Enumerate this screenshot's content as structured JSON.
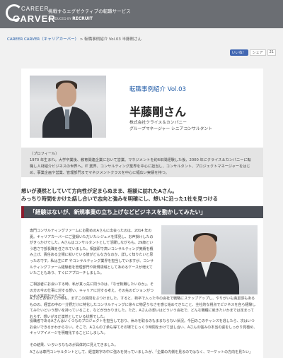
{
  "header": {
    "logo_line1": "CAREER",
    "logo_line2": "CARVER",
    "tagline": "挑戦するエグゼクティブの転職サービス",
    "produced_label": "PRODUCED BY",
    "produced_brand": "RECRUIT"
  },
  "breadcrumb": {
    "home": "CAREER CARVER（キャリアカーバー）",
    "separator": " > ",
    "current": "転職事例紹介 Vol.03 半藤剛さん"
  },
  "social": {
    "like_label": "いいね！",
    "share_label": "シェア",
    "share_count": "21"
  },
  "profile": {
    "series": "転職事例紹介 Vol.03",
    "name": "半藤剛さん",
    "company": "株式会社クライス＆カンパニー",
    "role": "グループマネージャー シニアコンサルタント"
  },
  "profile_box": {
    "heading": "（プロフィール）",
    "text": "1970 年生まれ。大学卒業後、教育関連企業において営業、マネジメントを約6年間経験した後、2000 年にクライス＆カンパニーに転職し人材紹介ビジネスの世界へ。IT 業界、コンサルティング業界を中心に担当し、コンサルタント、プロジェクトマネージャーをはじめ、事業企画や営業、管理部門までマネジメントクラスを中心に幅広い実績を持つ。"
  },
  "lead": {
    "line1": "想いが漠然としていて方向性が定まらぬまま、相談に訪れたAさん。",
    "line2": "みっちり時間をかけた話し合いで志向と強みを明確にし、想いに沿った1社を見つける"
  },
  "section": {
    "title": "「経験はないが、新規事業の立ち上げなどビジネスを動かしてみたい」"
  },
  "body": {
    "p1": "専門コンサルティングファームにお勤めのAさんに出会ったのは、2014 年の夏。キャリアカーバーにご登録いただいたレジュメを拝見し、お声掛けしたのがきっかけでした。Aさんはコンサルタントとして活躍しながらも、29歳という若さで部長職を任されていました。相談即で高いコンサルティング実績を積み上げ、責任ある立場に就いている彼がどんな方なのか、詳しく知りたいと思ったのです。私は主にIT やコンサルティング業界を担当していますが、コンサルティングファーム経験者を管理部門や新規領域としてあめるケースが増えていたこともあり、すぐにアプローチしました。",
    "p2": "ご相談者にお会いする時、私が真っ先に問うのは、「なぜ転職したいのか」。その方の今の仕事に対する想い、キャリアに対する考え、その先のビジョンがつかめる質問だからです。",
    "p3": "Aさんとお会いした時も、まずこの質問をぶつけました。すると、新卒で入った今の会社で戦略にステップアップし、やりがいも満足感もあるものの、経営の中の一分野だけに特化したコンサルティングに徐々に物足りなさを感じ始めてきたこと、全社的な視点でビジネスを自ら経験してみたいという想いを持っていること、などが分かりました。ただ、Aさんの想いはどういう会社で、どんな職種に就きたいかまでは定まっておらず、想いがまだ漠然としている状態でした。",
    "p4": "役職者であるAさんはいくつものプロジェクトを担当しており、休みを取るのもままならない状況。今回のこのチャンスを逃したら、次はいつお会いできるかわからない。そこで、Aさんの了承も得てその場でじっくり時間をかけて話し合い、Aさんの強みの本当の姿をしっかり見極め、キャリアイメージを明確化することにしました。",
    "p5": "その結果、いろいろなものが具体的に見えてきました。",
    "p6": "Aさんは専門コンサルタントとして、経営数字の中に強みを持っていましたが、「企業の内側を見るのではなく、マーケットの方向を見たい」"
  }
}
